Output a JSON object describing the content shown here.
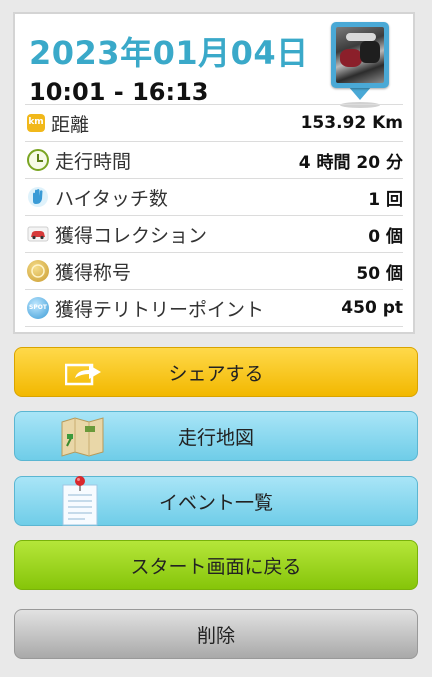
{
  "header": {
    "date": "2023年01月04日",
    "time_range": "10:01 - 16:13"
  },
  "stats": [
    {
      "icon": "km-icon",
      "label": "距離",
      "value": "153.92 Km"
    },
    {
      "icon": "clock-icon",
      "label": "走行時間",
      "value": "4 時間 20 分"
    },
    {
      "icon": "high-five-icon",
      "label": "ハイタッチ数",
      "value": "1 回"
    },
    {
      "icon": "car-icon",
      "label": "獲得コレクション",
      "value": "0 個"
    },
    {
      "icon": "medal-icon",
      "label": "獲得称号",
      "value": "50 個"
    },
    {
      "icon": "spot-icon",
      "label": "獲得テリトリーポイント",
      "value": "450 pt"
    }
  ],
  "icon_text": {
    "km": "km",
    "spot": "SPOT"
  },
  "buttons": {
    "share": "シェアする",
    "map": "走行地図",
    "events": "イベント一覧",
    "back_to_start": "スタート画面に戻る",
    "delete": "削除"
  },
  "colors": {
    "date": "#3aa9c9",
    "share": "#f2b800",
    "blue_buttons": "#6fcde8",
    "start": "#86c509",
    "delete": "#a9a9a9"
  }
}
